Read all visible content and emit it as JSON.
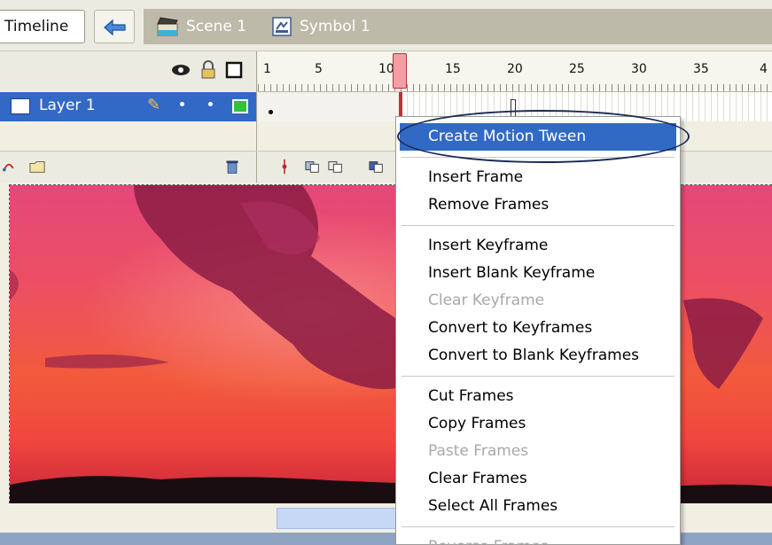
{
  "topbar": {
    "timeline_label": "Timeline",
    "back_icon": "back-arrow-icon",
    "scene_label": "Scene 1",
    "symbol_label": "Symbol 1"
  },
  "timeline": {
    "ruler_numbers": [
      "1",
      "5",
      "10",
      "15",
      "20",
      "25",
      "30",
      "35",
      "4"
    ],
    "layer_name": "Layer 1"
  },
  "context_menu": {
    "items": [
      {
        "label": "Create Motion Tween",
        "state": "highlighted"
      },
      {
        "label": "Insert Frame",
        "state": "enabled"
      },
      {
        "label": "Remove Frames",
        "state": "enabled"
      },
      {
        "label": "Insert Keyframe",
        "state": "enabled"
      },
      {
        "label": "Insert Blank Keyframe",
        "state": "enabled"
      },
      {
        "label": "Clear Keyframe",
        "state": "disabled"
      },
      {
        "label": "Convert to Keyframes",
        "state": "enabled"
      },
      {
        "label": "Convert to Blank Keyframes",
        "state": "enabled"
      },
      {
        "label": "Cut Frames",
        "state": "enabled"
      },
      {
        "label": "Copy Frames",
        "state": "enabled"
      },
      {
        "label": "Paste Frames",
        "state": "disabled"
      },
      {
        "label": "Clear Frames",
        "state": "enabled"
      },
      {
        "label": "Select All Frames",
        "state": "enabled"
      },
      {
        "label": "Reverse Frames",
        "state": "disabled"
      }
    ]
  },
  "colors": {
    "highlight": "#316ac5",
    "layer_selected": "#3268c6",
    "playhead": "#f29ea4"
  }
}
